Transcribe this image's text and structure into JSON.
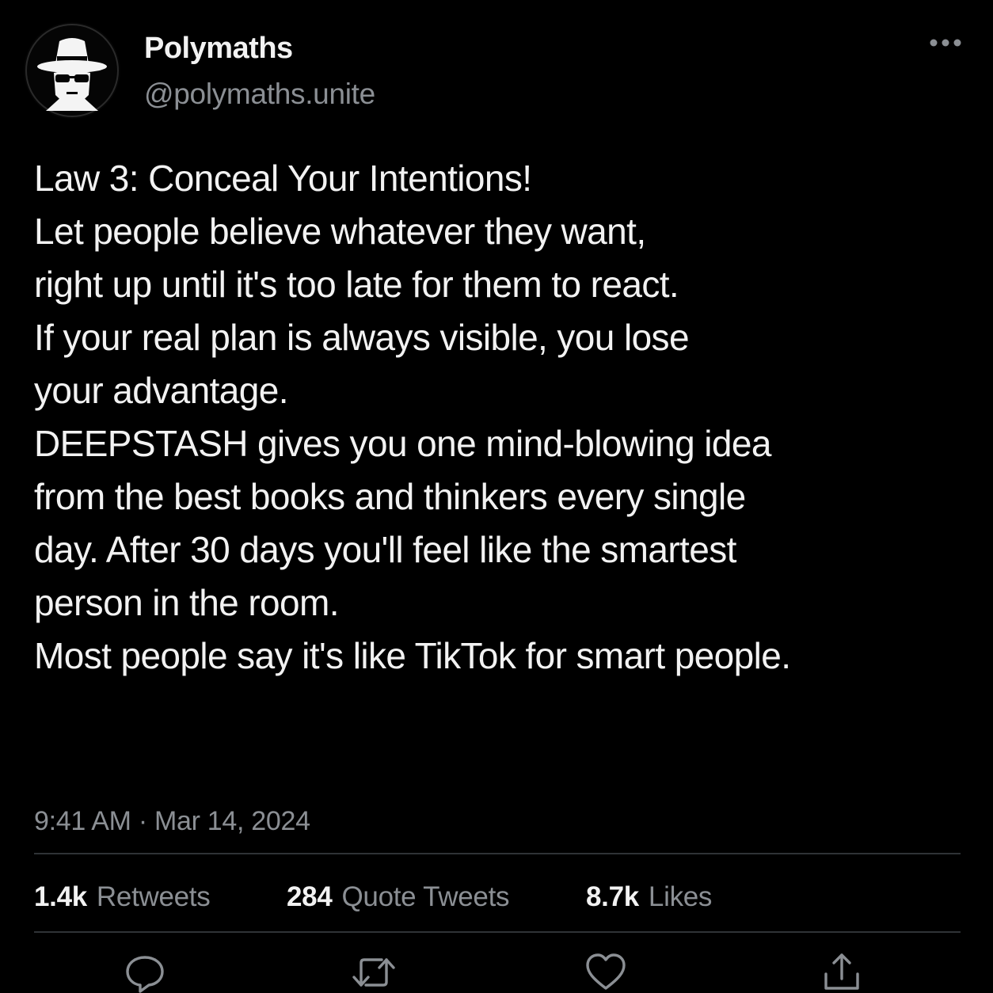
{
  "tweet": {
    "author": {
      "display_name": "Polymaths",
      "handle": "@polymaths.unite",
      "avatar_icon": "spy-hat-sunglasses-icon"
    },
    "more_icon": "more-horizontal-icon",
    "text": {
      "line_1": "Law 3: Conceal Your Intentions!",
      "line_2": "Let people believe whatever they want,",
      "line_3": "right up until it's too late for them to react.",
      "line_4": "If your real plan is always visible, you lose",
      "line_5": "your advantage.",
      "line_6": "DEEPSTASH gives you one mind-blowing idea",
      "line_7": "from the best books and thinkers every single",
      "line_8": "day. After 30 days you'll feel like the smartest",
      "line_9": "person in the room.",
      "line_10": "Most people say it's like TikTok for smart people."
    },
    "meta": {
      "time": "9:41 AM",
      "separator": "·",
      "date": "Mar 14, 2024"
    },
    "stats": {
      "retweets": {
        "count": "1.4k",
        "label": "Retweets"
      },
      "quote_tweets": {
        "count": "284",
        "label": "Quote Tweets"
      },
      "likes": {
        "count": "8.7k",
        "label": "Likes"
      }
    },
    "actions": [
      "reply-icon",
      "retweet-icon",
      "like-icon",
      "share-icon"
    ]
  },
  "colors": {
    "background": "#000000",
    "text_primary": "#f2f2f2",
    "text_secondary": "#8b8f94",
    "divider": "#2f3336"
  }
}
